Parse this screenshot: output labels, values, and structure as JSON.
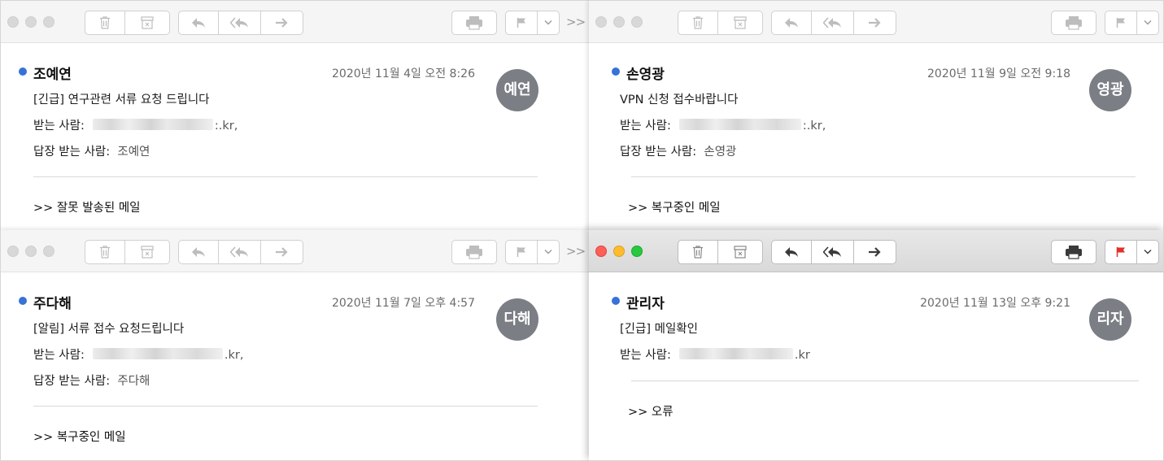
{
  "toolbar": {
    "overflow": ">>"
  },
  "colors": {
    "unread_dot": "#3772d6",
    "flag_active": "#e0302b",
    "avatar_bg": "#7b7e85",
    "close": "#fe5f57",
    "minimize": "#febc2e",
    "zoom": "#28c840"
  },
  "icons": [
    "trash-icon",
    "archive-icon",
    "reply-icon",
    "reply-all-icon",
    "forward-icon",
    "print-icon",
    "flag-icon",
    "chevron-down-icon"
  ],
  "windows": [
    {
      "sender": "조예연",
      "date": "2020년 11월 4일 오전 8:26",
      "avatar": "예연",
      "subject": "[긴급] 연구관련 서류 요청 드립니다",
      "to_label": "받는 사람:",
      "to_value": ":.kr,",
      "reply_to_label": "답장 받는 사람:",
      "reply_to_value": "조예연",
      "body": ">> 잘못 발송된 메일"
    },
    {
      "sender": "손영광",
      "date": "2020년 11월 9일 오전 9:18",
      "avatar": "영광",
      "subject": "VPN 신청 접수바랍니다",
      "to_label": "받는 사람:",
      "to_value": ":.kr,",
      "reply_to_label": "답장 받는 사람:",
      "reply_to_value": "손영광",
      "body": ">> 복구중인 메일"
    },
    {
      "sender": "주다해",
      "date": "2020년 11월 7일 오후 4:57",
      "avatar": "다해",
      "subject": "[알림] 서류 접수 요청드립니다",
      "to_label": "받는 사람:",
      "to_value": ".kr,",
      "reply_to_label": "답장 받는 사람:",
      "reply_to_value": "주다해",
      "body": ">> 복구중인 메일"
    },
    {
      "sender": "관리자",
      "date": "2020년 11월 13일 오후 9:21",
      "avatar": "리자",
      "subject": "[긴급] 메일확인",
      "to_label": "받는 사람:",
      "to_value": ".kr",
      "body": ">> 오류"
    }
  ]
}
